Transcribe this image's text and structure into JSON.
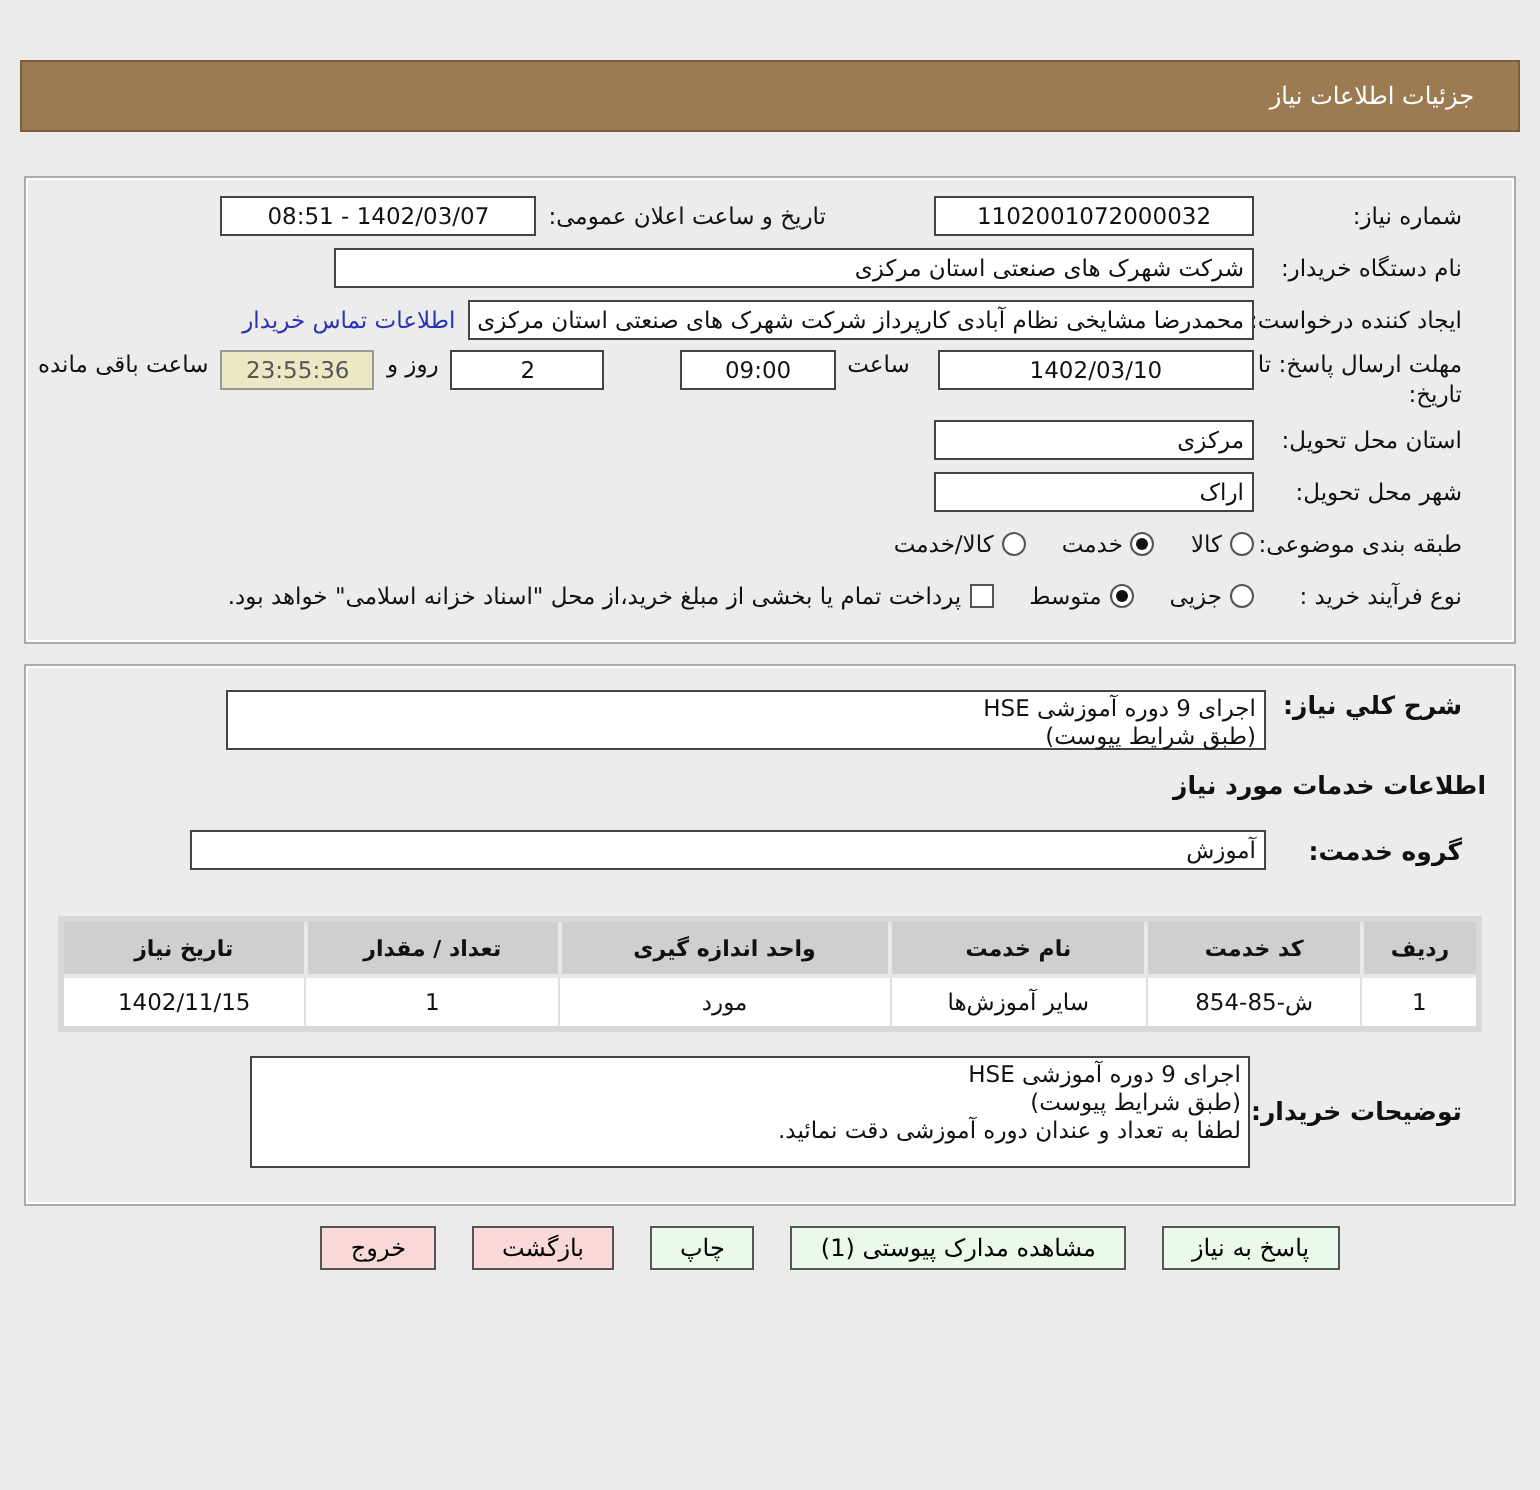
{
  "header": {
    "title": "جزئیات اطلاعات نیاز"
  },
  "need_number": {
    "label": "شماره نیاز:",
    "value": "1102001072000032"
  },
  "announce_datetime": {
    "label": "تاریخ و ساعت اعلان عمومی:",
    "value": "1402/03/07 - 08:51"
  },
  "buyer_org": {
    "label": "نام دستگاه خریدار:",
    "value": "شرکت شهرک های صنعتی استان مرکزی"
  },
  "requester": {
    "label": "ایجاد کننده درخواست:",
    "value": "محمدرضا مشایخی نظام آبادی کارپرداز شرکت شهرک های صنعتی استان مرکزی",
    "link": "اطلاعات تماس خریدار"
  },
  "deadline": {
    "label": "مهلت ارسال پاسخ: تا تاریخ:",
    "date": "1402/03/10",
    "time_label": "ساعت",
    "time": "09:00",
    "days": "2",
    "days_label": "روز و",
    "remaining": "23:55:36",
    "remaining_label": "ساعت باقی مانده"
  },
  "delivery_province": {
    "label": "استان محل تحویل:",
    "value": "مرکزی"
  },
  "delivery_city": {
    "label": "شهر محل تحویل:",
    "value": "اراک"
  },
  "subject_category": {
    "label": "طبقه بندی موضوعی:",
    "options": [
      {
        "label": "کالا",
        "selected": false
      },
      {
        "label": "خدمت",
        "selected": true
      },
      {
        "label": "کالا/خدمت",
        "selected": false
      }
    ]
  },
  "purchase_process": {
    "label": "نوع فرآیند خرید :",
    "options": [
      {
        "label": "جزیی",
        "selected": false
      },
      {
        "label": "متوسط",
        "selected": true
      }
    ],
    "treasury": {
      "label": "پرداخت تمام یا بخشی از مبلغ خرید،از محل \"اسناد خزانه اسلامی\" خواهد بود.",
      "checked": false
    }
  },
  "general_description": {
    "label": "شرح کلي نياز:",
    "lines": [
      "اجرای 9 دوره آموزشی HSE",
      "(طبق شرایط پیوست)"
    ]
  },
  "services_heading": "اطلاعات خدمات مورد نیاز",
  "service_group": {
    "label": "گروه خدمت:",
    "value": "آموزش"
  },
  "table": {
    "columns": [
      "ردیف",
      "کد خدمت",
      "نام خدمت",
      "واحد اندازه گیری",
      "تعداد / مقدار",
      "تاریخ نیاز"
    ],
    "rows": [
      [
        "1",
        "ش-85-854",
        "سایر آموزش‌ها",
        "مورد",
        "1",
        "1402/11/15"
      ]
    ]
  },
  "buyer_notes": {
    "label": "توضیحات خریدار:",
    "lines": [
      "اجرای 9 دوره آموزشی HSE",
      "(طبق شرایط پیوست)",
      "لطفا به تعداد و عندان دوره آموزشی دقت نمائید."
    ]
  },
  "buttons": [
    {
      "label": "پاسخ به نیاز",
      "kind": "primary"
    },
    {
      "label": "مشاهده مدارک پیوستی (1)",
      "kind": "primary"
    },
    {
      "label": "چاپ",
      "kind": "primary"
    },
    {
      "label": "بازگشت",
      "kind": "danger"
    },
    {
      "label": "خروج",
      "kind": "danger"
    }
  ]
}
